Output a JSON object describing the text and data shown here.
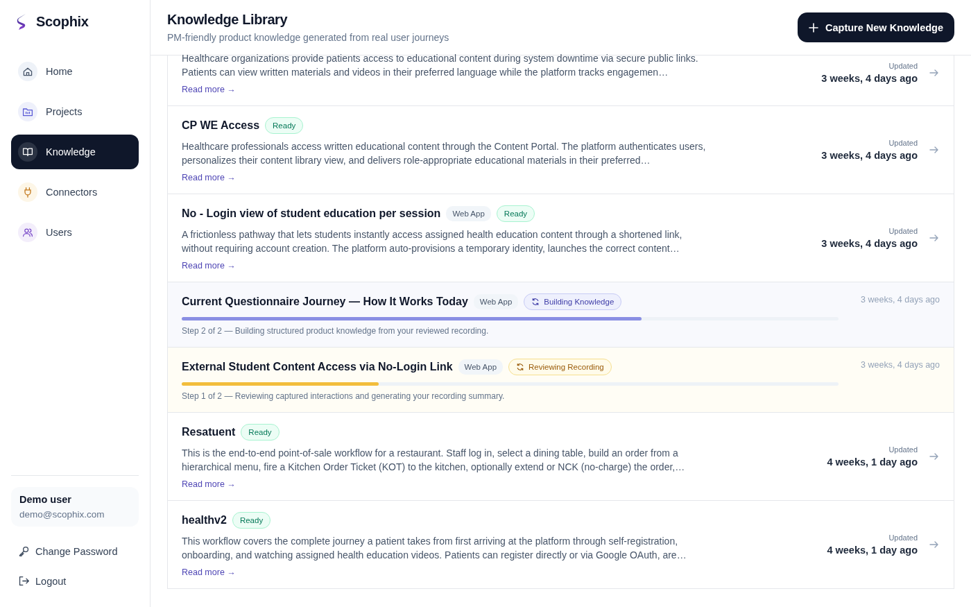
{
  "brand": {
    "name": "Scophix"
  },
  "nav": [
    {
      "label": "Home",
      "kind": "home",
      "selected": false
    },
    {
      "label": "Projects",
      "kind": "projects",
      "selected": false
    },
    {
      "label": "Knowledge",
      "kind": "knowledge",
      "selected": true
    },
    {
      "label": "Connectors",
      "kind": "connectors",
      "selected": false
    },
    {
      "label": "Users",
      "kind": "users",
      "selected": false
    }
  ],
  "user": {
    "name": "Demo user",
    "email": "demo@scophix.com"
  },
  "account_links": [
    {
      "label": "Change Password",
      "kind": "key"
    },
    {
      "label": "Logout",
      "kind": "logout"
    }
  ],
  "header": {
    "title": "Knowledge Library",
    "subtitle": "PM-friendly product knowledge generated from real user journeys",
    "action": "Capture New Knowledge"
  },
  "items": [
    {
      "kind": "ready",
      "description": "Healthcare organizations provide patients access to educational content during system downtime via secure public links. Patients can view written materials and videos in their preferred language while the platform tracks engagemen…",
      "link": "Read more →",
      "updated_label": "Updated",
      "updated": "3 weeks, 4 days ago"
    },
    {
      "kind": "ready",
      "title": "CP WE Access",
      "status": "Ready",
      "description": "Healthcare professionals access written educational content through the Content Portal. The platform authenticates users, personalizes their content library view, and delivers role-appropriate educational materials in their preferred…",
      "link": "Read more →",
      "updated_label": "Updated",
      "updated": "3 weeks, 4 days ago"
    },
    {
      "kind": "ready",
      "title": "No - Login view of student education per session",
      "tags": [
        "Web App"
      ],
      "status": "Ready",
      "description": "A frictionless pathway that lets students instantly access assigned health education content through a shortened link, without requiring account creation. The platform auto-provisions a temporary identity, launches the correct content…",
      "link": "Read more →",
      "updated_label": "Updated",
      "updated": "3 weeks, 4 days ago"
    },
    {
      "kind": "building",
      "title": "Current Questionnaire Journey — How It Works Today",
      "tags": [
        "Web App"
      ],
      "status": "Building Knowledge",
      "level": 0.7,
      "step": "Step 2 of 2 — Building structured product knowledge from your reviewed recording.",
      "updated": "3 weeks, 4 days ago"
    },
    {
      "kind": "reviewing",
      "title": "External Student Content Access via No-Login Link",
      "tags": [
        "Web App"
      ],
      "status": "Reviewing Recording",
      "level": 0.3,
      "step": "Step 1 of 2 — Reviewing captured interactions and generating your recording summary.",
      "updated": "3 weeks, 4 days ago"
    },
    {
      "kind": "ready",
      "title": "Resatuent",
      "status": "Ready",
      "description": "This is the end-to-end point-of-sale workflow for a restaurant. Staff log in, select a dining table, build an order from a hierarchical menu, fire a Kitchen Order Ticket (KOT) to the kitchen, optionally extend or NCK (no-charge) the order,…",
      "link": "Read more →",
      "updated_label": "Updated",
      "updated": "4 weeks, 1 day ago"
    },
    {
      "kind": "ready",
      "title": "healthv2",
      "status": "Ready",
      "description": "This workflow covers the complete journey a patient takes from first arriving at the platform through self-registration, onboarding, and watching assigned health education videos. Patients can register directly or via Google OAuth, are…",
      "link": "Read more →",
      "updated_label": "Updated",
      "updated": "4 weeks, 1 day ago"
    }
  ]
}
